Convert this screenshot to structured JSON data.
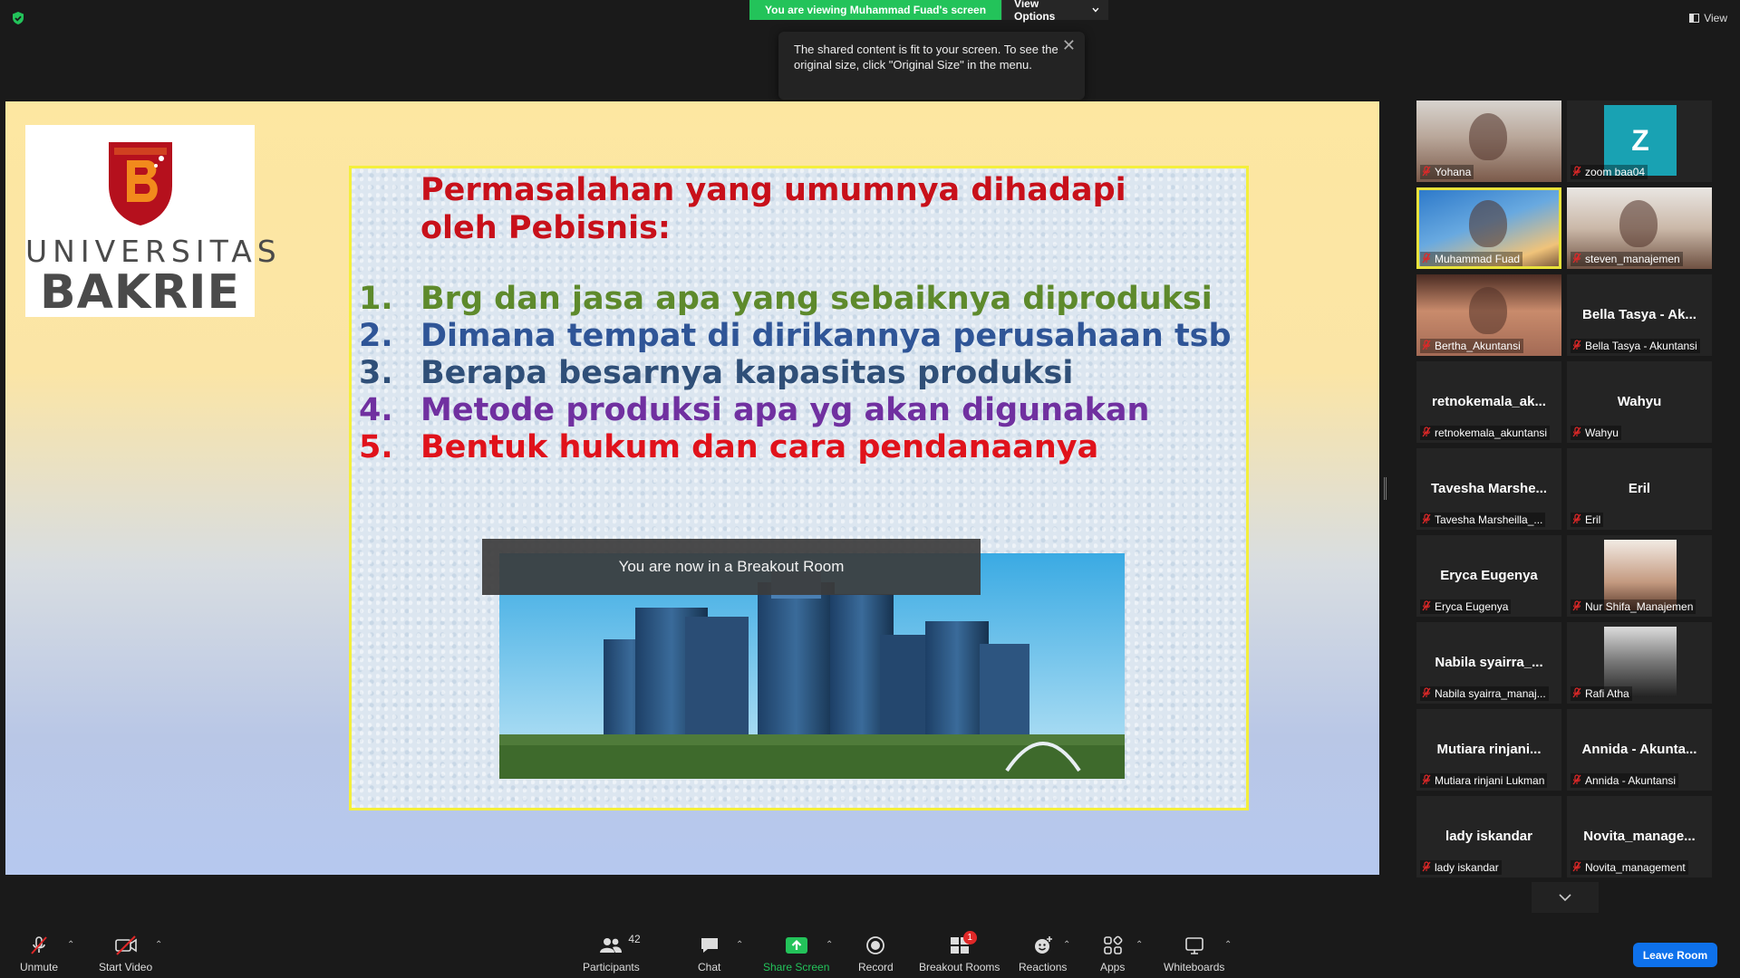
{
  "top_bar": {
    "viewing_banner": "You are viewing Muhammad Fuad's screen",
    "view_options": "View Options",
    "view_label": "View",
    "tooltip_text": "The shared content is fit to your screen. To see the original size, click \"Original Size\" in the menu."
  },
  "slide": {
    "logo_line1": "UNIVERSITAS",
    "logo_line2": "BAKRIE",
    "title": "Permasalahan yang umumnya dihadapi oleh Pebisnis:",
    "items": [
      {
        "num": "1.",
        "text": "Brg dan jasa apa yang sebaiknya diproduksi",
        "color": "#5e8a2c"
      },
      {
        "num": "2.",
        "text": "Dimana tempat di dirikannya perusahaan tsb",
        "color": "#2f5597"
      },
      {
        "num": "3.",
        "text": "Berapa besarnya kapasitas produksi",
        "color": "#2f4f78"
      },
      {
        "num": "4.",
        "text": "Metode produksi apa yg akan digunakan",
        "color": "#7030a0"
      },
      {
        "num": "5.",
        "text": "Bentuk hukum dan cara pendanaanya",
        "color": "#e0121b"
      }
    ]
  },
  "breakout_toast": "You are now in a Breakout Room",
  "participants": [
    {
      "tile_name": "",
      "label": "Yohana",
      "type": "video"
    },
    {
      "tile_name": "Z",
      "label": "zoom baa04",
      "type": "avatar"
    },
    {
      "tile_name": "",
      "label": "Muhammad Fuad",
      "type": "video",
      "active": true
    },
    {
      "tile_name": "",
      "label": "steven_manajemen",
      "type": "video"
    },
    {
      "tile_name": "",
      "label": "Bertha_Akuntansi",
      "type": "video"
    },
    {
      "tile_name": "Bella Tasya - Ak...",
      "label": "Bella Tasya - Akuntansi",
      "type": "name"
    },
    {
      "tile_name": "retnokemala_ak...",
      "label": "retnokemala_akuntansi",
      "type": "name"
    },
    {
      "tile_name": "Wahyu",
      "label": "Wahyu",
      "type": "name"
    },
    {
      "tile_name": "Tavesha  Marshe...",
      "label": "Tavesha Marsheilla_...",
      "type": "name"
    },
    {
      "tile_name": "Eril",
      "label": "Eril",
      "type": "name"
    },
    {
      "tile_name": "Eryca Eugenya",
      "label": "Eryca Eugenya",
      "type": "name"
    },
    {
      "tile_name": "",
      "label": "Nur Shifa_Manajemen",
      "type": "photo"
    },
    {
      "tile_name": "Nabila  syairra_...",
      "label": "Nabila syairra_manaj...",
      "type": "name"
    },
    {
      "tile_name": "",
      "label": "Rafi Atha",
      "type": "photo"
    },
    {
      "tile_name": "Mutiara  rinjani...",
      "label": "Mutiara rinjani Lukman",
      "type": "name"
    },
    {
      "tile_name": "Annida - Akunta...",
      "label": "Annida - Akuntansi",
      "type": "name"
    },
    {
      "tile_name": "lady iskandar",
      "label": "lady iskandar",
      "type": "name"
    },
    {
      "tile_name": "Novita_manage...",
      "label": "Novita_management",
      "type": "name"
    }
  ],
  "toolbar": {
    "unmute": "Unmute",
    "start_video": "Start Video",
    "participants": "Participants",
    "participants_count": "42",
    "chat": "Chat",
    "share_screen": "Share Screen",
    "record": "Record",
    "breakout_rooms": "Breakout Rooms",
    "breakout_badge": "1",
    "reactions": "Reactions",
    "apps": "Apps",
    "whiteboards": "Whiteboards",
    "leave_room": "Leave Room"
  },
  "colors": {
    "share_green": "#23c35a",
    "leave_blue": "#0e71eb",
    "active_speaker": "#e8e23a",
    "muted_red": "#e02828"
  }
}
